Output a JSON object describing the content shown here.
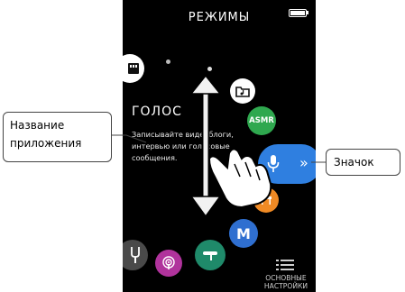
{
  "screen": {
    "title": "РЕЖИМЫ",
    "mode_name": "ГОЛОС",
    "mode_description": "Записывайте видеоблоги, интервью или голосовые сообщения.",
    "mode_icons": {
      "sd_card": "sd-card-icon",
      "folder": "folder-music-icon",
      "asmr_label": "ASMR",
      "voice": "microphone-icon",
      "next": "double-chevron-icon",
      "piano": "piano-icon",
      "m_label": "M",
      "fork": "tuning-fork-icon",
      "podcast": "podcast-icon",
      "instrument": "instrument-icon"
    },
    "menu": {
      "line1": "ОСНОВНЫЕ",
      "line2": "НАСТРОЙКИ"
    },
    "colors": {
      "voice_active": "#2f7fe0",
      "asmr": "#2fa84f",
      "piano": "#f08a24",
      "m": "#2f6fd0",
      "podcast": "#b0339c",
      "instrument": "#1f8a6a"
    }
  },
  "callouts": {
    "app_name_line1": "Название",
    "app_name_line2": "приложения",
    "icon": "Значок"
  }
}
